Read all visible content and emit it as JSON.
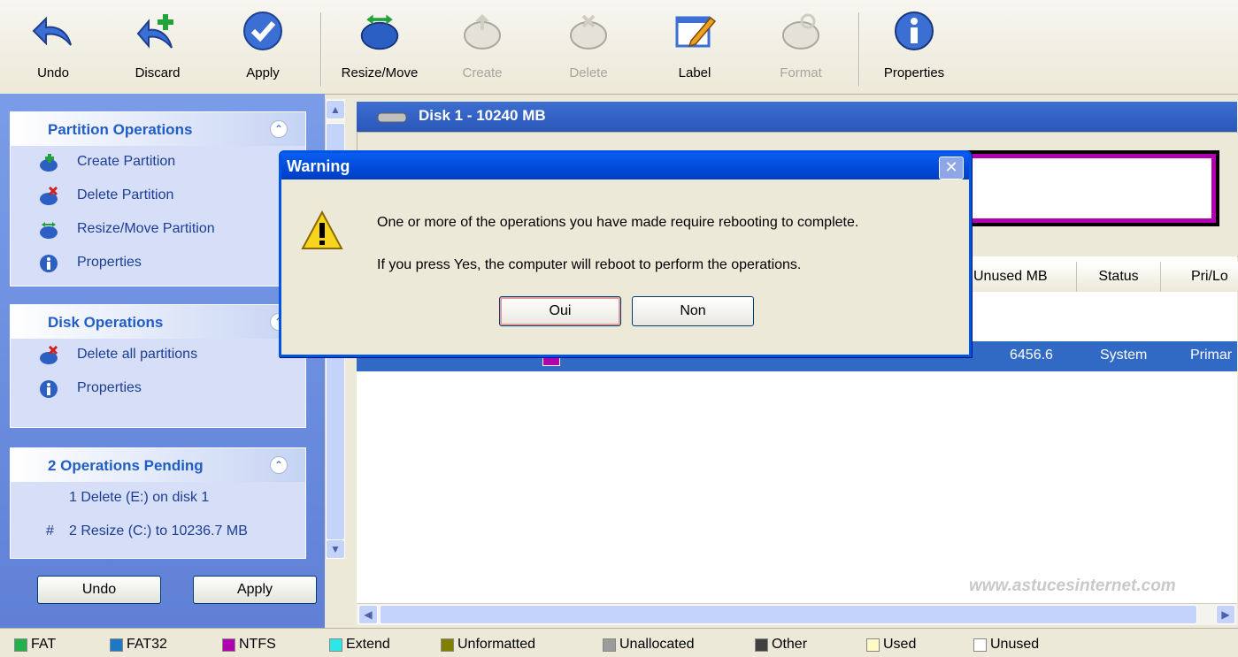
{
  "toolbar": {
    "undo": "Undo",
    "discard": "Discard",
    "apply": "Apply",
    "resize_move": "Resize/Move",
    "create": "Create",
    "delete": "Delete",
    "label": "Label",
    "format": "Format",
    "properties": "Properties"
  },
  "sidebar": {
    "partition_ops": {
      "title": "Partition Operations",
      "items": [
        "Create Partition",
        "Delete Partition",
        "Resize/Move Partition",
        "Properties"
      ]
    },
    "disk_ops": {
      "title": "Disk Operations",
      "items": [
        "Delete all partitions",
        "Properties"
      ]
    },
    "pending": {
      "title": "2 Operations Pending",
      "items": [
        {
          "prefix": "",
          "text": "1 Delete (E:) on disk 1"
        },
        {
          "prefix": "#",
          "text": "2 Resize (C:) to 10236.7 MB"
        }
      ]
    },
    "undo_button": "Undo",
    "apply_button": "Apply"
  },
  "disk": {
    "title": "Disk 1 - 10240 MB",
    "columns": [
      "Unused MB",
      "Status",
      "Pri/Lo"
    ],
    "row": {
      "unused": "6456.6",
      "status": "System",
      "type": "Primar"
    }
  },
  "dialog": {
    "title": "Warning",
    "line1": "One or more of the operations you have made require rebooting to complete.",
    "line2": "If you press Yes, the computer will reboot to perform the operations.",
    "yes": "Oui",
    "no": "Non"
  },
  "legend": [
    "FAT",
    "FAT32",
    "NTFS",
    "Extend",
    "Unformatted",
    "Unallocated",
    "Other",
    "Used",
    "Unused"
  ],
  "legend_colors": [
    "#22b14c",
    "#1e78c8",
    "#b000b0",
    "#2ee6e6",
    "#7f7f00",
    "#9c9c9c",
    "#404040",
    "#fffac8",
    "#ffffff"
  ],
  "watermark": "www.astucesinternet.com"
}
